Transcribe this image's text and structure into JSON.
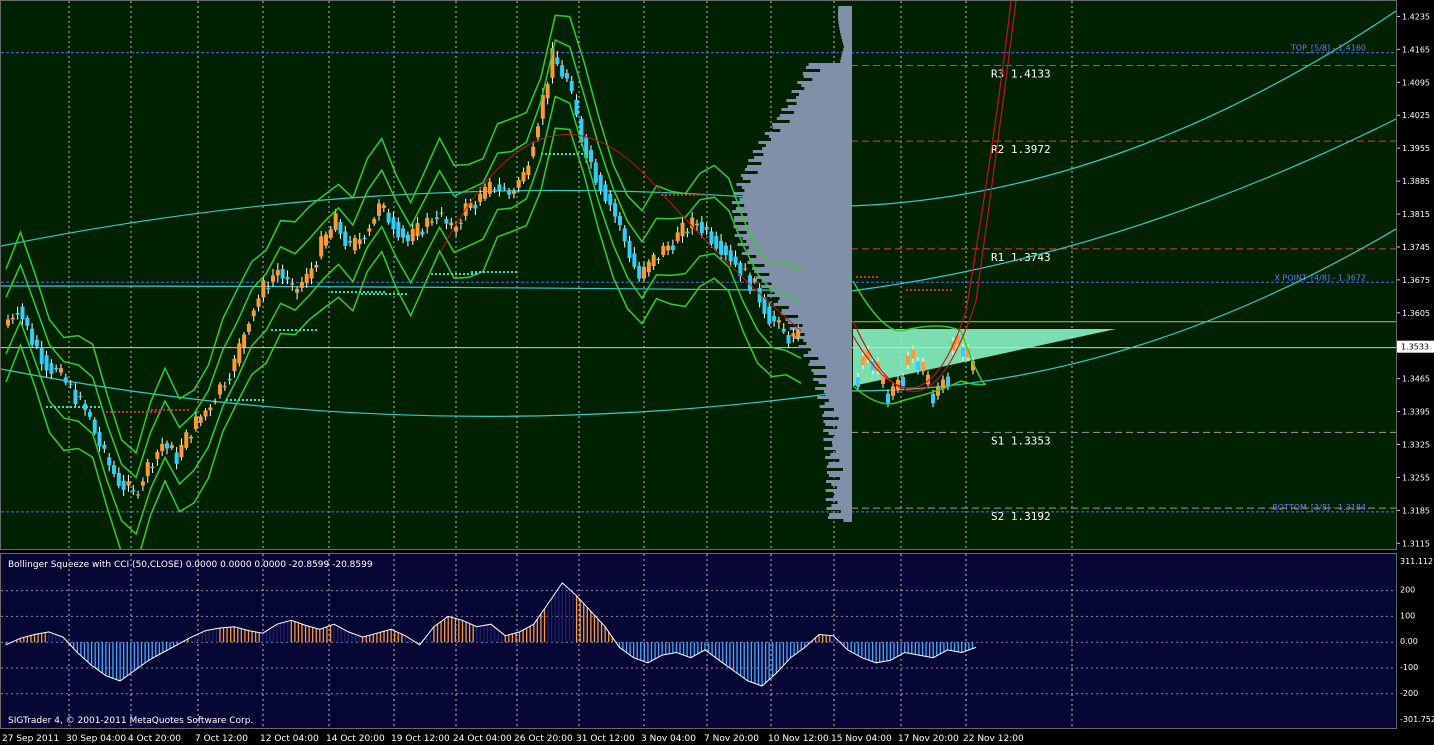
{
  "chart_data": [
    {
      "type": "line",
      "symbol_panel": "main",
      "y_axis_ticks": [
        "1.4235",
        "1.4165",
        "1.4095",
        "1.4025",
        "1.3955",
        "1.3885",
        "1.3815",
        "1.3745",
        "1.3675",
        "1.3605",
        "1.3535",
        "1.3465",
        "1.3395",
        "1.3325",
        "1.3255",
        "1.3185",
        "1.3115"
      ],
      "ylim": [
        1.3105,
        1.427
      ],
      "current_price": "1.3533",
      "pivot_levels": [
        {
          "name": "R3",
          "value": "1.4133",
          "price": 1.4133
        },
        {
          "name": "R2",
          "value": "1.3972",
          "price": 1.3972
        },
        {
          "name": "R1",
          "value": "1.3743",
          "price": 1.3743
        },
        {
          "name": "S1",
          "value": "1.3353",
          "price": 1.3353
        },
        {
          "name": "S2",
          "value": "1.3192",
          "price": 1.3192
        }
      ],
      "murrey_levels": [
        {
          "label": "TOP_[5/8] - 1.4160",
          "price": 1.416
        },
        {
          "label": "X POINT_[4/8] - 1.3672",
          "price": 1.3672
        },
        {
          "label": "BOTTOM_[3/8] - 1.3184",
          "price": 1.3184
        }
      ],
      "x_axis_labels": [
        "27 Sep 2011",
        "30 Sep 04:00",
        "4 Oct 20:00",
        "7 Oct 12:00",
        "12 Oct 04:00",
        "14 Oct 20:00",
        "19 Oct 12:00",
        "24 Oct 04:00",
        "26 Oct 20:00",
        "31 Oct 12:00",
        "3 Nov 04:00",
        "7 Nov 20:00",
        "10 Nov 12:00",
        "15 Nov 04:00",
        "17 Nov 20:00",
        "22 Nov 12:00"
      ],
      "price_series": [
        1.358,
        1.362,
        1.355,
        1.35,
        1.347,
        1.343,
        1.338,
        1.33,
        1.325,
        1.322,
        1.328,
        1.333,
        1.33,
        1.336,
        1.34,
        1.345,
        1.35,
        1.36,
        1.366,
        1.37,
        1.365,
        1.368,
        1.375,
        1.38,
        1.374,
        1.378,
        1.383,
        1.38,
        1.376,
        1.379,
        1.382,
        1.378,
        1.383,
        1.385,
        1.388,
        1.386,
        1.39,
        1.402,
        1.415,
        1.41,
        1.398,
        1.39,
        1.384,
        1.376,
        1.368,
        1.372,
        1.375,
        1.378,
        1.38,
        1.377,
        1.374,
        1.37,
        1.366,
        1.36,
        1.356,
        1.355
      ]
    },
    {
      "type": "bar",
      "symbol_panel": "indicator",
      "title": "Bollinger Squeeze with CCI (50,CLOSE) 0.0000 0.0000 0.0000 -20.8599 -20.8599",
      "y_axis_ticks": [
        "311.112",
        "200",
        "100",
        "0.00",
        "-100",
        "-200",
        "-301.752"
      ],
      "ylim": [
        -301.752,
        311.112
      ],
      "cci_values": [
        -10,
        15,
        30,
        40,
        20,
        -40,
        -90,
        -130,
        -150,
        -110,
        -70,
        -40,
        -10,
        20,
        45,
        55,
        60,
        45,
        35,
        70,
        85,
        65,
        50,
        70,
        40,
        20,
        35,
        50,
        25,
        -10,
        60,
        100,
        85,
        60,
        70,
        25,
        40,
        70,
        150,
        230,
        180,
        120,
        60,
        -20,
        -60,
        -80,
        -50,
        -40,
        -60,
        -30,
        -70,
        -110,
        -150,
        -170,
        -120,
        -60,
        -20,
        30,
        25,
        -30,
        -60,
        -80,
        -70,
        -40,
        -50,
        -60,
        -30,
        -40,
        -20
      ]
    }
  ],
  "footer": {
    "copyright": "SIGTrader 4, © 2001-2011 MetaQuotes Software Corp."
  },
  "colors": {
    "background": "#002200",
    "indicator_bg": "#060635",
    "bull_candle": "#ff9933",
    "bear_candle": "#33ccff",
    "bands": "#33cc33",
    "arcs": "#33cccc",
    "fan": "#8fffd0",
    "volume_profile": "#8090a8"
  }
}
